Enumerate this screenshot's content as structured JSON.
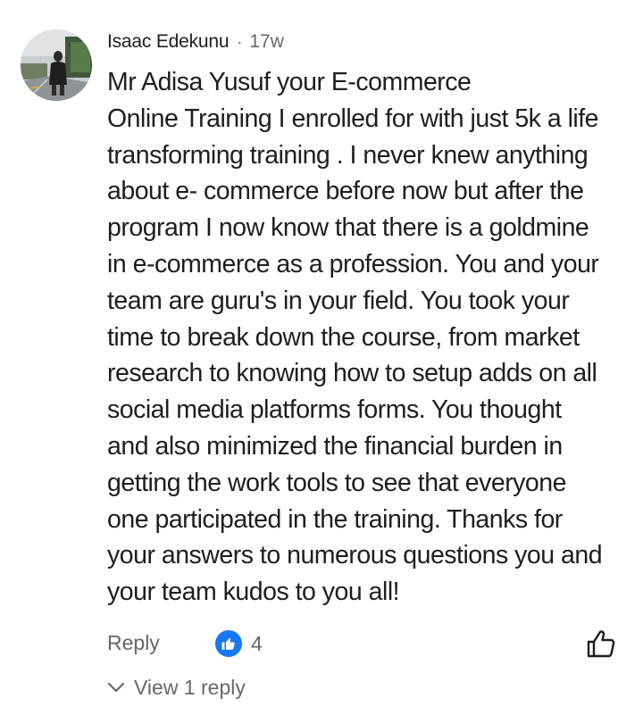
{
  "comment": {
    "author": "Isaac Edekunu",
    "separator": "·",
    "time": "17w",
    "lines": [
      "Mr Adisa Yusuf your E-commerce",
      "Online Training I enrolled for with just 5k a life",
      "transforming training . I never knew anything",
      "about e- commerce before now but after the",
      "program I now know that there is a goldmine",
      "in e-commerce as a profession. You and your",
      "team are guru's in your field. You took your",
      "time to break down the course, from market",
      "research to knowing how to setup adds on all",
      "social media platforms forms. You thought",
      "and also minimized the financial burden in",
      "getting the work tools to see that everyone",
      "one participated in the training. Thanks for",
      "your answers to numerous questions you and",
      "your team kudos to you all!"
    ]
  },
  "actions": {
    "reply_label": "Reply",
    "reaction_count": "4",
    "reaction_icon": "like-icon",
    "like_button_icon": "thumbs-up-outline-icon"
  },
  "replies": {
    "label": "View 1 reply",
    "icon": "chevron-down-icon"
  },
  "colors": {
    "text": "#1c1e21",
    "secondary": "#65676b",
    "like_blue": "#1877f2"
  }
}
